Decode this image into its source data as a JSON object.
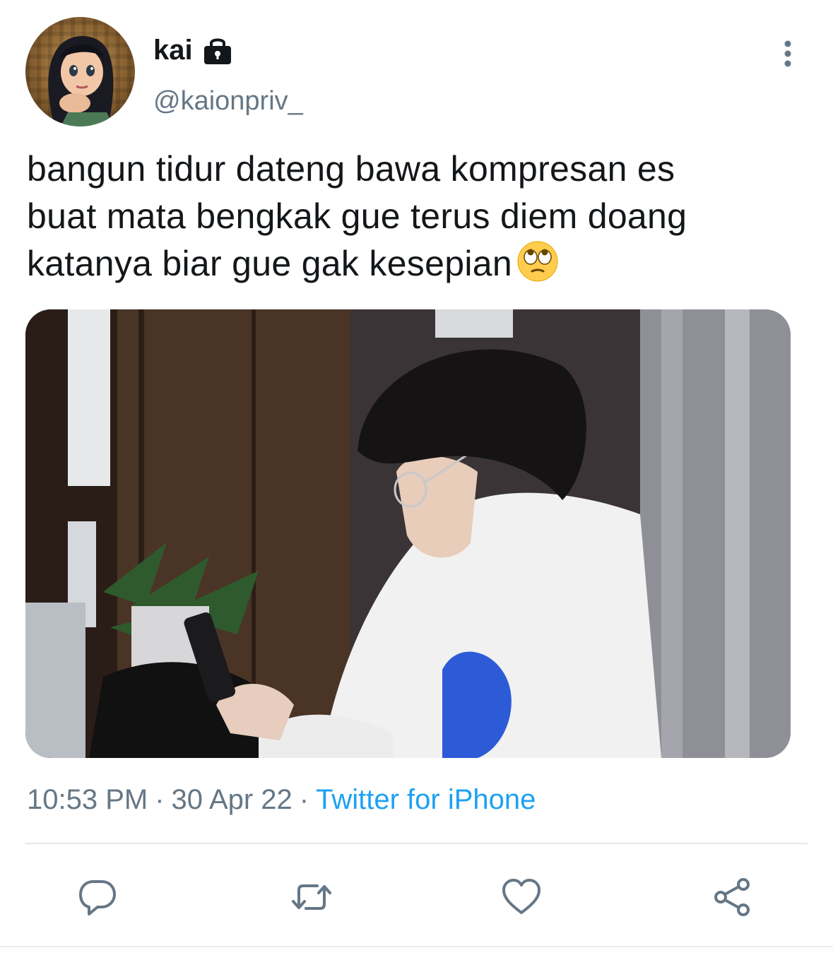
{
  "user": {
    "display_name": "kai",
    "handle": "@kaionpriv_",
    "protected_icon": "lock-icon",
    "avatar_icon": "avatar-image"
  },
  "tweet": {
    "text_lines": [
      "bangun tidur dateng bawa kompresan es",
      "buat mata bengkak gue terus diem doang",
      "katanya biar gue gak kesepian"
    ],
    "emoji": "face-with-rolling-eyes"
  },
  "media": {
    "type": "photo"
  },
  "meta": {
    "time": "10:53 PM",
    "separator": "·",
    "date": "30 Apr 22",
    "source": "Twitter for iPhone"
  },
  "actions": [
    "reply-icon",
    "retweet-icon",
    "like-icon",
    "share-icon"
  ],
  "colors": {
    "text": "#14171a",
    "secondary": "#657786",
    "accent": "#1da1f2",
    "divider": "#e1e8ed"
  }
}
